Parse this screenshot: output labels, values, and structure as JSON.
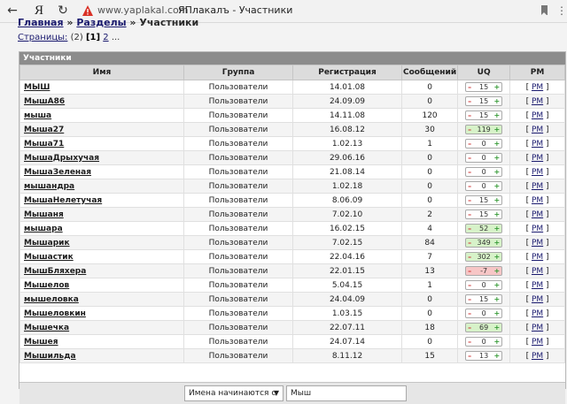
{
  "browser": {
    "domain": "www.yaplakal.com",
    "title": "ЯПлакалъ - Участники",
    "yandex_label": "Я"
  },
  "crumbs": {
    "home": "Главная",
    "sep1": "»",
    "sections": "Разделы",
    "sep2": "»",
    "current": "Участники"
  },
  "pages": {
    "label": "Страницы:",
    "count": "(2)",
    "current": "[1]",
    "next": "2",
    "more": "..."
  },
  "panel_title": "Участники",
  "columns": [
    "Имя",
    "Группа",
    "Регистрация",
    "Сообщений",
    "UQ",
    "PM"
  ],
  "pm_label": "PM",
  "rows": [
    {
      "name": "МЫШ",
      "group": "Пользователи",
      "reg": "14.01.08",
      "posts": "0",
      "uq": "15",
      "uq_tone": "neutral"
    },
    {
      "name": "МышА86",
      "group": "Пользователи",
      "reg": "24.09.09",
      "posts": "0",
      "uq": "15",
      "uq_tone": "neutral"
    },
    {
      "name": "мыша",
      "group": "Пользователи",
      "reg": "14.11.08",
      "posts": "120",
      "uq": "15",
      "uq_tone": "neutral"
    },
    {
      "name": "Мыша27",
      "group": "Пользователи",
      "reg": "16.08.12",
      "posts": "30",
      "uq": "119",
      "uq_tone": "pos"
    },
    {
      "name": "Мыша71",
      "group": "Пользователи",
      "reg": "1.02.13",
      "posts": "1",
      "uq": "0",
      "uq_tone": "neutral"
    },
    {
      "name": "МышаДрыхучая",
      "group": "Пользователи",
      "reg": "29.06.16",
      "posts": "0",
      "uq": "0",
      "uq_tone": "neutral"
    },
    {
      "name": "МышаЗеленая",
      "group": "Пользователи",
      "reg": "21.08.14",
      "posts": "0",
      "uq": "0",
      "uq_tone": "neutral"
    },
    {
      "name": "мышандра",
      "group": "Пользователи",
      "reg": "1.02.18",
      "posts": "0",
      "uq": "0",
      "uq_tone": "neutral"
    },
    {
      "name": "МышаНелетучая",
      "group": "Пользователи",
      "reg": "8.06.09",
      "posts": "0",
      "uq": "15",
      "uq_tone": "neutral"
    },
    {
      "name": "Мышаня",
      "group": "Пользователи",
      "reg": "7.02.10",
      "posts": "2",
      "uq": "15",
      "uq_tone": "neutral"
    },
    {
      "name": "мышара",
      "group": "Пользователи",
      "reg": "16.02.15",
      "posts": "4",
      "uq": "52",
      "uq_tone": "pos"
    },
    {
      "name": "Мышарик",
      "group": "Пользователи",
      "reg": "7.02.15",
      "posts": "84",
      "uq": "349",
      "uq_tone": "pos"
    },
    {
      "name": "Мышастик",
      "group": "Пользователи",
      "reg": "22.04.16",
      "posts": "7",
      "uq": "302",
      "uq_tone": "pos"
    },
    {
      "name": "МышБляхера",
      "group": "Пользователи",
      "reg": "22.01.15",
      "posts": "13",
      "uq": "-7",
      "uq_tone": "neg"
    },
    {
      "name": "Мышелов",
      "group": "Пользователи",
      "reg": "5.04.15",
      "posts": "1",
      "uq": "0",
      "uq_tone": "neutral"
    },
    {
      "name": "мышеловка",
      "group": "Пользователи",
      "reg": "24.04.09",
      "posts": "0",
      "uq": "15",
      "uq_tone": "neutral"
    },
    {
      "name": "Мышеловкин",
      "group": "Пользователи",
      "reg": "1.03.15",
      "posts": "0",
      "uq": "0",
      "uq_tone": "neutral"
    },
    {
      "name": "Мышечка",
      "group": "Пользователи",
      "reg": "22.07.11",
      "posts": "18",
      "uq": "69",
      "uq_tone": "pos"
    },
    {
      "name": "Мышея",
      "group": "Пользователи",
      "reg": "24.07.14",
      "posts": "0",
      "uq": "0",
      "uq_tone": "neutral"
    },
    {
      "name": "Мышильда",
      "group": "Пользователи",
      "reg": "8.11.12",
      "posts": "15",
      "uq": "13",
      "uq_tone": "neutral"
    }
  ],
  "filter": {
    "select_value": "Имена начинаются с",
    "input_value": "Мыш"
  },
  "colors": {
    "panel_header": "#8c8c8c",
    "uq_positive": "#d7f2c9",
    "uq_negative": "#f7c6c6"
  }
}
